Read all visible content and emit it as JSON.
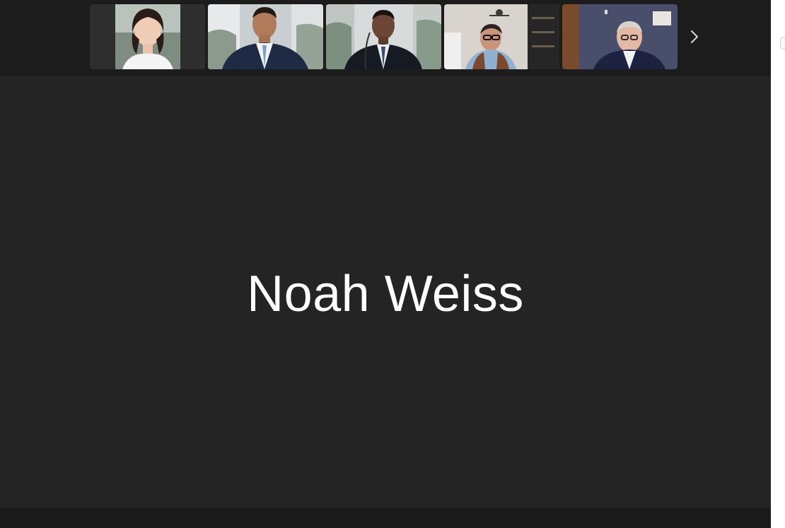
{
  "meeting": {
    "active_speaker_name": "Noah Weiss"
  },
  "gallery": {
    "participants": [
      {
        "id": "p1",
        "video": "woman-portrait"
      },
      {
        "id": "p2",
        "video": "man-suit-office"
      },
      {
        "id": "p3",
        "video": "man-suit-microphone"
      },
      {
        "id": "p4",
        "video": "man-glasses-home"
      },
      {
        "id": "p5",
        "video": "man-glasses-office"
      }
    ],
    "next_icon": "chevron-right-icon"
  },
  "colors": {
    "stage_background": "#242424",
    "strip_background": "#1c1c1c",
    "name_text": "#ffffff"
  }
}
